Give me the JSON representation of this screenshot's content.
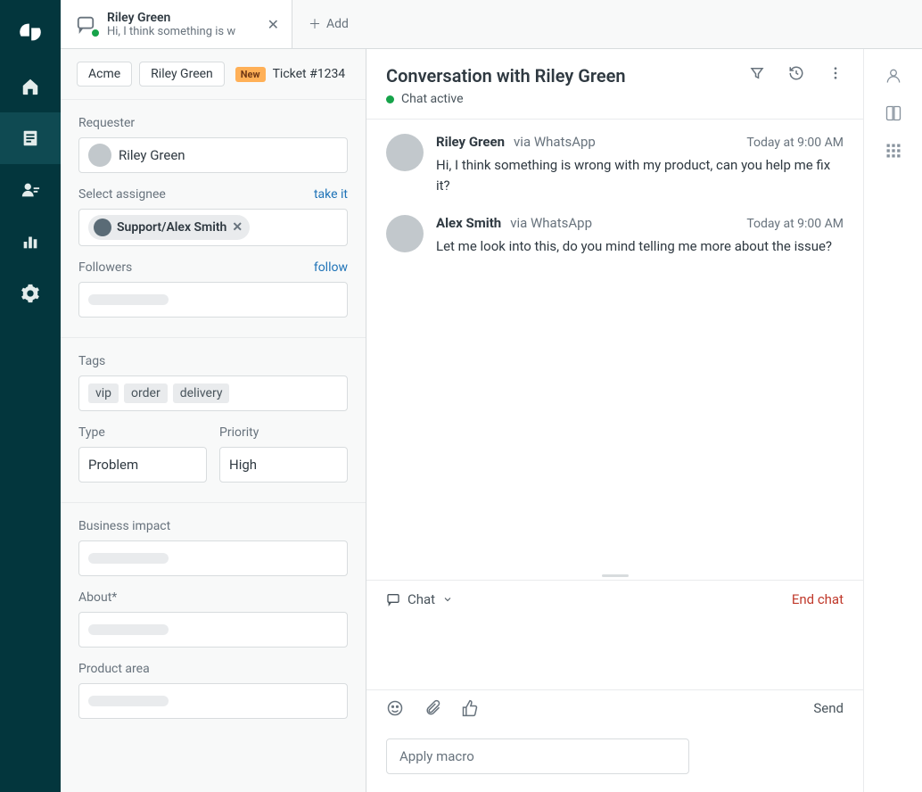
{
  "tab": {
    "title": "Riley Green",
    "subtitle": "Hi, I think something is w",
    "add_label": "Add"
  },
  "breadcrumbs": {
    "org": "Acme",
    "requester": "Riley Green",
    "badge": "New",
    "ticket": "Ticket #1234"
  },
  "sidebar": {
    "requester_label": "Requester",
    "requester_value": "Riley Green",
    "assignee_label": "Select assignee",
    "take_it": "take it",
    "assignee_chip": "Support/Alex Smith",
    "followers_label": "Followers",
    "follow": "follow",
    "tags_label": "Tags",
    "tags": [
      "vip",
      "order",
      "delivery"
    ],
    "type_label": "Type",
    "type_value": "Problem",
    "priority_label": "Priority",
    "priority_value": "High",
    "business_impact_label": "Business impact",
    "about_label": "About*",
    "product_area_label": "Product area"
  },
  "conversation": {
    "title": "Conversation with Riley Green",
    "status": "Chat active",
    "messages": [
      {
        "author": "Riley Green",
        "via": "via WhatsApp",
        "time": "Today at 9:00 AM",
        "text": "Hi, I think something is wrong with my product, can you help me fix it?"
      },
      {
        "author": "Alex Smith",
        "via": "via WhatsApp",
        "time": "Today at 9:00 AM",
        "text": "Let me look into this, do you mind telling me more about the issue?"
      }
    ]
  },
  "reply": {
    "channel": "Chat",
    "end_chat": "End chat",
    "send": "Send",
    "macro_placeholder": "Apply macro"
  }
}
